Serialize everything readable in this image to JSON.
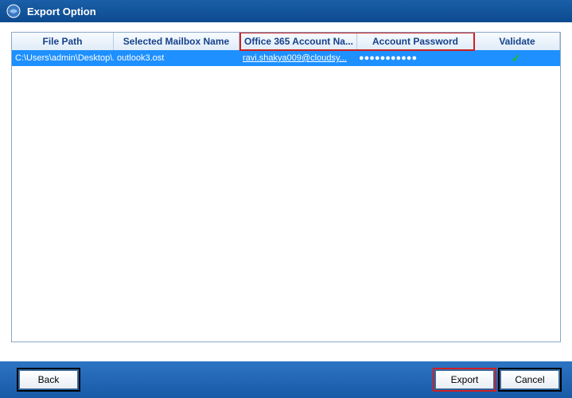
{
  "window": {
    "title": "Export Option"
  },
  "columns": {
    "file_path": "File Path",
    "selected_mailbox": "Selected Mailbox Name",
    "o365_account": "Office 365 Account Na...",
    "account_password": "Account Password",
    "validate": "Validate"
  },
  "rows": [
    {
      "file_path": "C:\\Users\\admin\\Desktop\\...",
      "mailbox": "outlook3.ost",
      "account": "ravi.shakya009@cloudsy...",
      "password_mask": "●●●●●●●●●●●",
      "validated": true
    }
  ],
  "buttons": {
    "back": "Back",
    "export": "Export",
    "cancel": "Cancel"
  }
}
